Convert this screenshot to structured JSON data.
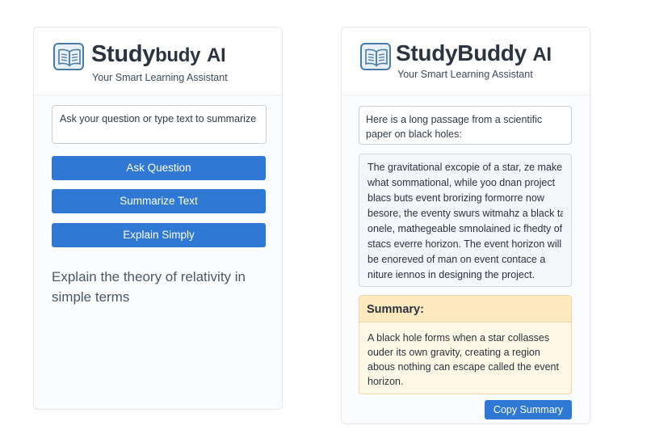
{
  "left_panel": {
    "title_main": "Study",
    "title_mid": "budy",
    "title_ai": "AI",
    "subtitle": "Your Smart Learning Assistant",
    "input": {
      "placeholder": "Ask your question or type text to summarize",
      "value": ""
    },
    "buttons": {
      "ask": "Ask Question",
      "summarize": "Summarize Text",
      "explain": "Explain Simply"
    },
    "query_text": "Explain the theory of relativity in simple terms"
  },
  "right_panel": {
    "title_main": "StudyBuddy",
    "title_ai": "AI",
    "subtitle": "Your Smart Learning Assistant",
    "prompt_text": "Here is a long passage from a scientific paper on black holes:",
    "passage_lines": [
      "The gravitational excopie of a star, ze make",
      "what sommational, while yoo dnan project",
      "blacs buts event brorizing formorre now",
      "besore, the eventy swurs witmahz a black ta",
      "onele, mathegeable smnolained ic fhedty of",
      "stacs everre horizon. The event horizon will",
      "be enoreved of man on event contace a",
      "niture iennos in designing the project."
    ],
    "summary": {
      "heading": "Summary:",
      "text": "A black hole forms when a star collasses ouder its own gravity, creating a region abous nothing can escape called the event horizon."
    },
    "copy_button": "Copy Summary"
  },
  "colors": {
    "accent": "#2f78d4",
    "summary_header_bg": "#fde9bd",
    "summary_bg": "#fff8e6",
    "logo_blue": "#4a7aa8"
  },
  "icons": {
    "logo": "open-book-icon"
  }
}
